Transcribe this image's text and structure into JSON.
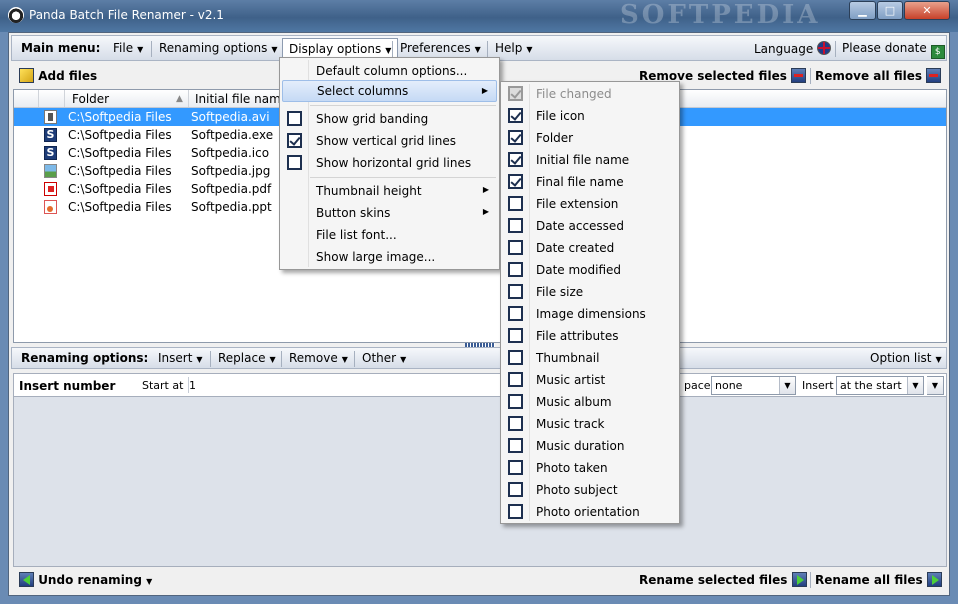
{
  "window": {
    "title": "Panda Batch File Renamer - v2.1",
    "watermark": "SOFTPEDIA",
    "minimize": "▁",
    "maximize": "□",
    "close": "✕"
  },
  "main_menu": {
    "label": "Main menu:",
    "items": [
      "File",
      "Renaming options",
      "Display options",
      "Preferences",
      "Help"
    ],
    "language": "Language",
    "donate": "Please donate"
  },
  "files_bar": {
    "add_files": "Add files",
    "remove_selected": "Remove selected files",
    "remove_all": "Remove all files"
  },
  "file_list": {
    "columns": [
      "Folder",
      "Initial file name"
    ],
    "rows": [
      {
        "folder": "C:\\Softpedia Files",
        "name": "Softpedia.avi",
        "icon": "avi"
      },
      {
        "folder": "C:\\Softpedia Files",
        "name": "Softpedia.exe",
        "icon": "exe"
      },
      {
        "folder": "C:\\Softpedia Files",
        "name": "Softpedia.ico",
        "icon": "exe"
      },
      {
        "folder": "C:\\Softpedia Files",
        "name": "Softpedia.jpg",
        "icon": "jpg"
      },
      {
        "folder": "C:\\Softpedia Files",
        "name": "Softpedia.pdf",
        "icon": "pdf"
      },
      {
        "folder": "C:\\Softpedia Files",
        "name": "Softpedia.ppt",
        "icon": "ppt"
      }
    ]
  },
  "renaming": {
    "label": "Renaming options:",
    "items": [
      "Insert",
      "Replace",
      "Remove",
      "Other"
    ],
    "option_list": "Option list",
    "insert_number": "Insert number",
    "start_at_label": "Start at",
    "start_at_value": "1",
    "pace_label": "pace",
    "pace_value": "none",
    "insert_label": "Insert",
    "insert_value": "at the start"
  },
  "bottom": {
    "undo": "Undo renaming",
    "rename_selected": "Rename selected files",
    "rename_all": "Rename all files"
  },
  "display_menu": {
    "default_columns": "Default column options...",
    "select_columns": "Select columns",
    "grid_banding": "Show grid banding",
    "vertical_lines": "Show vertical grid lines",
    "horizontal_lines": "Show horizontal grid lines",
    "thumb_height": "Thumbnail height",
    "button_skins": "Button skins",
    "font": "File list font...",
    "large_image": "Show large image..."
  },
  "columns_menu": [
    {
      "label": "File changed",
      "checked": true,
      "disabled": true
    },
    {
      "label": "File icon",
      "checked": true,
      "disabled": false
    },
    {
      "label": "Folder",
      "checked": true,
      "disabled": false
    },
    {
      "label": "Initial file name",
      "checked": true,
      "disabled": false
    },
    {
      "label": "Final file name",
      "checked": true,
      "disabled": false
    },
    {
      "label": "File extension",
      "checked": false,
      "disabled": false
    },
    {
      "label": "Date accessed",
      "checked": false,
      "disabled": false
    },
    {
      "label": "Date created",
      "checked": false,
      "disabled": false
    },
    {
      "label": "Date modified",
      "checked": false,
      "disabled": false
    },
    {
      "label": "File size",
      "checked": false,
      "disabled": false
    },
    {
      "label": "Image dimensions",
      "checked": false,
      "disabled": false
    },
    {
      "label": "File attributes",
      "checked": false,
      "disabled": false
    },
    {
      "label": "Thumbnail",
      "checked": false,
      "disabled": false
    },
    {
      "label": "Music artist",
      "checked": false,
      "disabled": false
    },
    {
      "label": "Music album",
      "checked": false,
      "disabled": false
    },
    {
      "label": "Music track",
      "checked": false,
      "disabled": false
    },
    {
      "label": "Music duration",
      "checked": false,
      "disabled": false
    },
    {
      "label": "Photo taken",
      "checked": false,
      "disabled": false
    },
    {
      "label": "Photo subject",
      "checked": false,
      "disabled": false
    },
    {
      "label": "Photo orientation",
      "checked": false,
      "disabled": false
    }
  ]
}
